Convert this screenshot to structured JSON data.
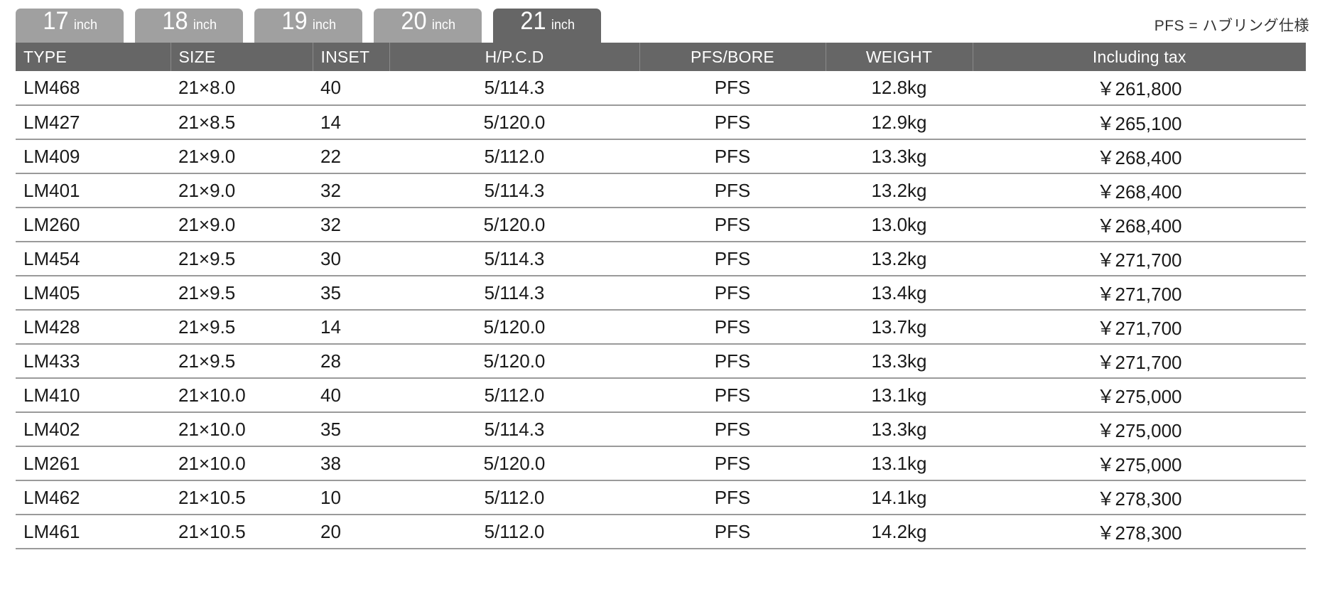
{
  "tabs": [
    {
      "number": "17",
      "unit": "inch",
      "active": false
    },
    {
      "number": "18",
      "unit": "inch",
      "active": false
    },
    {
      "number": "19",
      "unit": "inch",
      "active": false
    },
    {
      "number": "20",
      "unit": "inch",
      "active": false
    },
    {
      "number": "21",
      "unit": "inch",
      "active": true
    }
  ],
  "note": "PFS = ハブリング仕様",
  "table": {
    "columns": [
      {
        "key": "type",
        "label": "TYPE",
        "align": "left"
      },
      {
        "key": "size",
        "label": "SIZE",
        "align": "left"
      },
      {
        "key": "inset",
        "label": "INSET",
        "align": "left"
      },
      {
        "key": "pcd",
        "label": "H/P.C.D",
        "align": "center"
      },
      {
        "key": "pfs",
        "label": "PFS/BORE",
        "align": "center"
      },
      {
        "key": "weight",
        "label": "WEIGHT",
        "align": "center"
      },
      {
        "key": "price",
        "label": "Including tax",
        "align": "center"
      }
    ],
    "rows": [
      {
        "type": "LM468",
        "size": "21×8.0",
        "inset": "40",
        "pcd": "5/114.3",
        "pfs": "PFS",
        "weight": "12.8kg",
        "price": "￥261,800"
      },
      {
        "type": "LM427",
        "size": "21×8.5",
        "inset": "14",
        "pcd": "5/120.0",
        "pfs": "PFS",
        "weight": "12.9kg",
        "price": "￥265,100"
      },
      {
        "type": "LM409",
        "size": "21×9.0",
        "inset": "22",
        "pcd": "5/112.0",
        "pfs": "PFS",
        "weight": "13.3kg",
        "price": "￥268,400"
      },
      {
        "type": "LM401",
        "size": "21×9.0",
        "inset": "32",
        "pcd": "5/114.3",
        "pfs": "PFS",
        "weight": "13.2kg",
        "price": "￥268,400"
      },
      {
        "type": "LM260",
        "size": "21×9.0",
        "inset": "32",
        "pcd": "5/120.0",
        "pfs": "PFS",
        "weight": "13.0kg",
        "price": "￥268,400"
      },
      {
        "type": "LM454",
        "size": "21×9.5",
        "inset": "30",
        "pcd": "5/114.3",
        "pfs": "PFS",
        "weight": "13.2kg",
        "price": "￥271,700"
      },
      {
        "type": "LM405",
        "size": "21×9.5",
        "inset": "35",
        "pcd": "5/114.3",
        "pfs": "PFS",
        "weight": "13.4kg",
        "price": "￥271,700"
      },
      {
        "type": "LM428",
        "size": "21×9.5",
        "inset": "14",
        "pcd": "5/120.0",
        "pfs": "PFS",
        "weight": "13.7kg",
        "price": "￥271,700"
      },
      {
        "type": "LM433",
        "size": "21×9.5",
        "inset": "28",
        "pcd": "5/120.0",
        "pfs": "PFS",
        "weight": "13.3kg",
        "price": "￥271,700"
      },
      {
        "type": "LM410",
        "size": "21×10.0",
        "inset": "40",
        "pcd": "5/112.0",
        "pfs": "PFS",
        "weight": "13.1kg",
        "price": "￥275,000"
      },
      {
        "type": "LM402",
        "size": "21×10.0",
        "inset": "35",
        "pcd": "5/114.3",
        "pfs": "PFS",
        "weight": "13.3kg",
        "price": "￥275,000"
      },
      {
        "type": "LM261",
        "size": "21×10.0",
        "inset": "38",
        "pcd": "5/120.0",
        "pfs": "PFS",
        "weight": "13.1kg",
        "price": "￥275,000"
      },
      {
        "type": "LM462",
        "size": "21×10.5",
        "inset": "10",
        "pcd": "5/112.0",
        "pfs": "PFS",
        "weight": "14.1kg",
        "price": "￥278,300"
      },
      {
        "type": "LM461",
        "size": "21×10.5",
        "inset": "20",
        "pcd": "5/112.0",
        "pfs": "PFS",
        "weight": "14.2kg",
        "price": "￥278,300"
      }
    ]
  },
  "colors": {
    "header_bg": "#666666",
    "tab_inactive_bg": "#a0a0a0",
    "tab_active_bg": "#666666",
    "row_rule": "#9a9a9a",
    "text": "#1a1a1a"
  }
}
